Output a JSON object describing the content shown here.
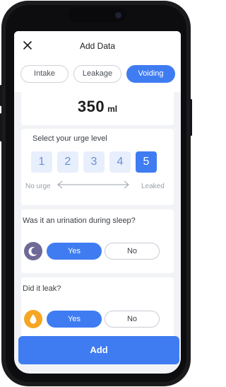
{
  "header": {
    "title": "Add Data",
    "close_icon": "close-icon"
  },
  "tabs": [
    {
      "label": "Intake",
      "active": false
    },
    {
      "label": "Leakage",
      "active": false
    },
    {
      "label": "Voiding",
      "active": true
    }
  ],
  "volume": {
    "value": "350",
    "unit": "ml"
  },
  "urge": {
    "label": "Select your urge level",
    "levels": [
      "1",
      "2",
      "3",
      "4",
      "5"
    ],
    "selected": "5",
    "min_label": "No urge",
    "max_label": "Leaked"
  },
  "sleep": {
    "question": "Was it an urination during sleep?",
    "yes": "Yes",
    "no": "No",
    "selected": "Yes",
    "icon": "moon-icon"
  },
  "leak": {
    "question": "Did it leak?",
    "yes": "Yes",
    "no": "No",
    "selected": "Yes",
    "icon": "droplet-icon"
  },
  "footer": {
    "add_label": "Add"
  },
  "colors": {
    "accent": "#3f7cf2",
    "moon_bg": "#6e6a97",
    "drop_bg": "#f5a623",
    "background": "#f2f3f6"
  }
}
